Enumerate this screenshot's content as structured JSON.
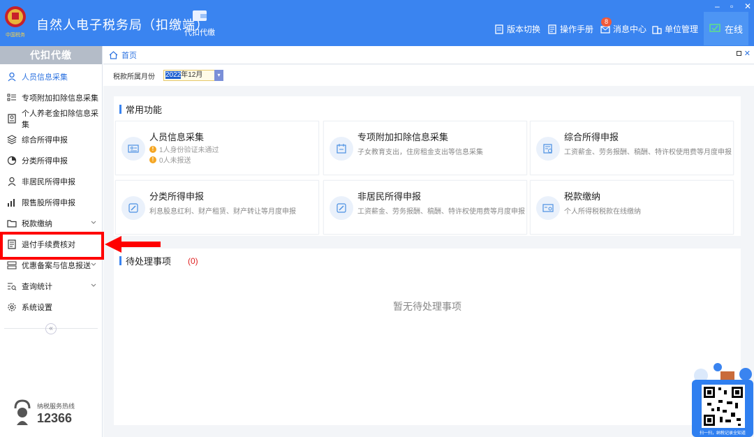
{
  "header": {
    "app_title": "自然人电子税务局（扣缴端）",
    "nav_tab": "代扣代缴",
    "links": [
      {
        "label": "版本切换",
        "icon": "doc-icon"
      },
      {
        "label": "操作手册",
        "icon": "manual-icon"
      },
      {
        "label": "消息中心",
        "icon": "mail-icon"
      },
      {
        "label": "单位管理",
        "icon": "building-icon"
      }
    ],
    "message_badge": "8",
    "status": "在线",
    "brand_color": "#3a84f0"
  },
  "sidebar": {
    "title": "代扣代缴",
    "items": [
      {
        "label": "人员信息采集",
        "icon": "person-icon",
        "active": true
      },
      {
        "label": "专项附加扣除信息采集",
        "icon": "list-icon"
      },
      {
        "label": "个人养老金扣除信息采集",
        "icon": "id-card-icon"
      },
      {
        "label": "综合所得申报",
        "icon": "layers-icon"
      },
      {
        "label": "分类所得申报",
        "icon": "pie-icon"
      },
      {
        "label": "非居民所得申报",
        "icon": "user-icon"
      },
      {
        "label": "限售股所得申报",
        "icon": "bar-chart-icon"
      },
      {
        "label": "税款缴纳",
        "icon": "folder-icon",
        "expandable": true
      },
      {
        "label": "退付手续费核对",
        "icon": "receipt-icon",
        "highlighted": true
      },
      {
        "label": "优惠备案与信息报送",
        "icon": "stack-icon",
        "expandable": true
      },
      {
        "label": "查询统计",
        "icon": "search-list-icon",
        "expandable": true
      },
      {
        "label": "系统设置",
        "icon": "gear-icon"
      }
    ],
    "hotline_label": "纳税服务热线",
    "hotline_number": "12366"
  },
  "main": {
    "breadcrumb": "首页",
    "period_label": "税款所属月份",
    "period_year": "2022",
    "period_rest": "年12月",
    "common_title": "常用功能",
    "cards": [
      {
        "title": "人员信息采集",
        "lines": [
          "1人身份验证未通过",
          "0人未报送"
        ]
      },
      {
        "title": "专项附加扣除信息采集",
        "desc": "子女教育支出，住房租金支出等信息采集"
      },
      {
        "title": "综合所得申报",
        "desc": "工资薪金、劳务报酬、稿酬、特许权使用费等月度申报"
      },
      {
        "title": "分类所得申报",
        "desc": "利息股息红利、财产租赁、财产转让等月度申报"
      },
      {
        "title": "非居民所得申报",
        "desc": "工资薪金、劳务报酬、稿酬、特许权使用费等月度申报"
      },
      {
        "title": "税款缴纳",
        "desc": "个人所得税税款在线缴纳"
      }
    ],
    "pending_title": "待处理事项",
    "pending_count": "(0)",
    "pending_empty": "暂无待处理事项"
  },
  "widget": {
    "caption": "扫一扫，纳税记录全知道"
  }
}
